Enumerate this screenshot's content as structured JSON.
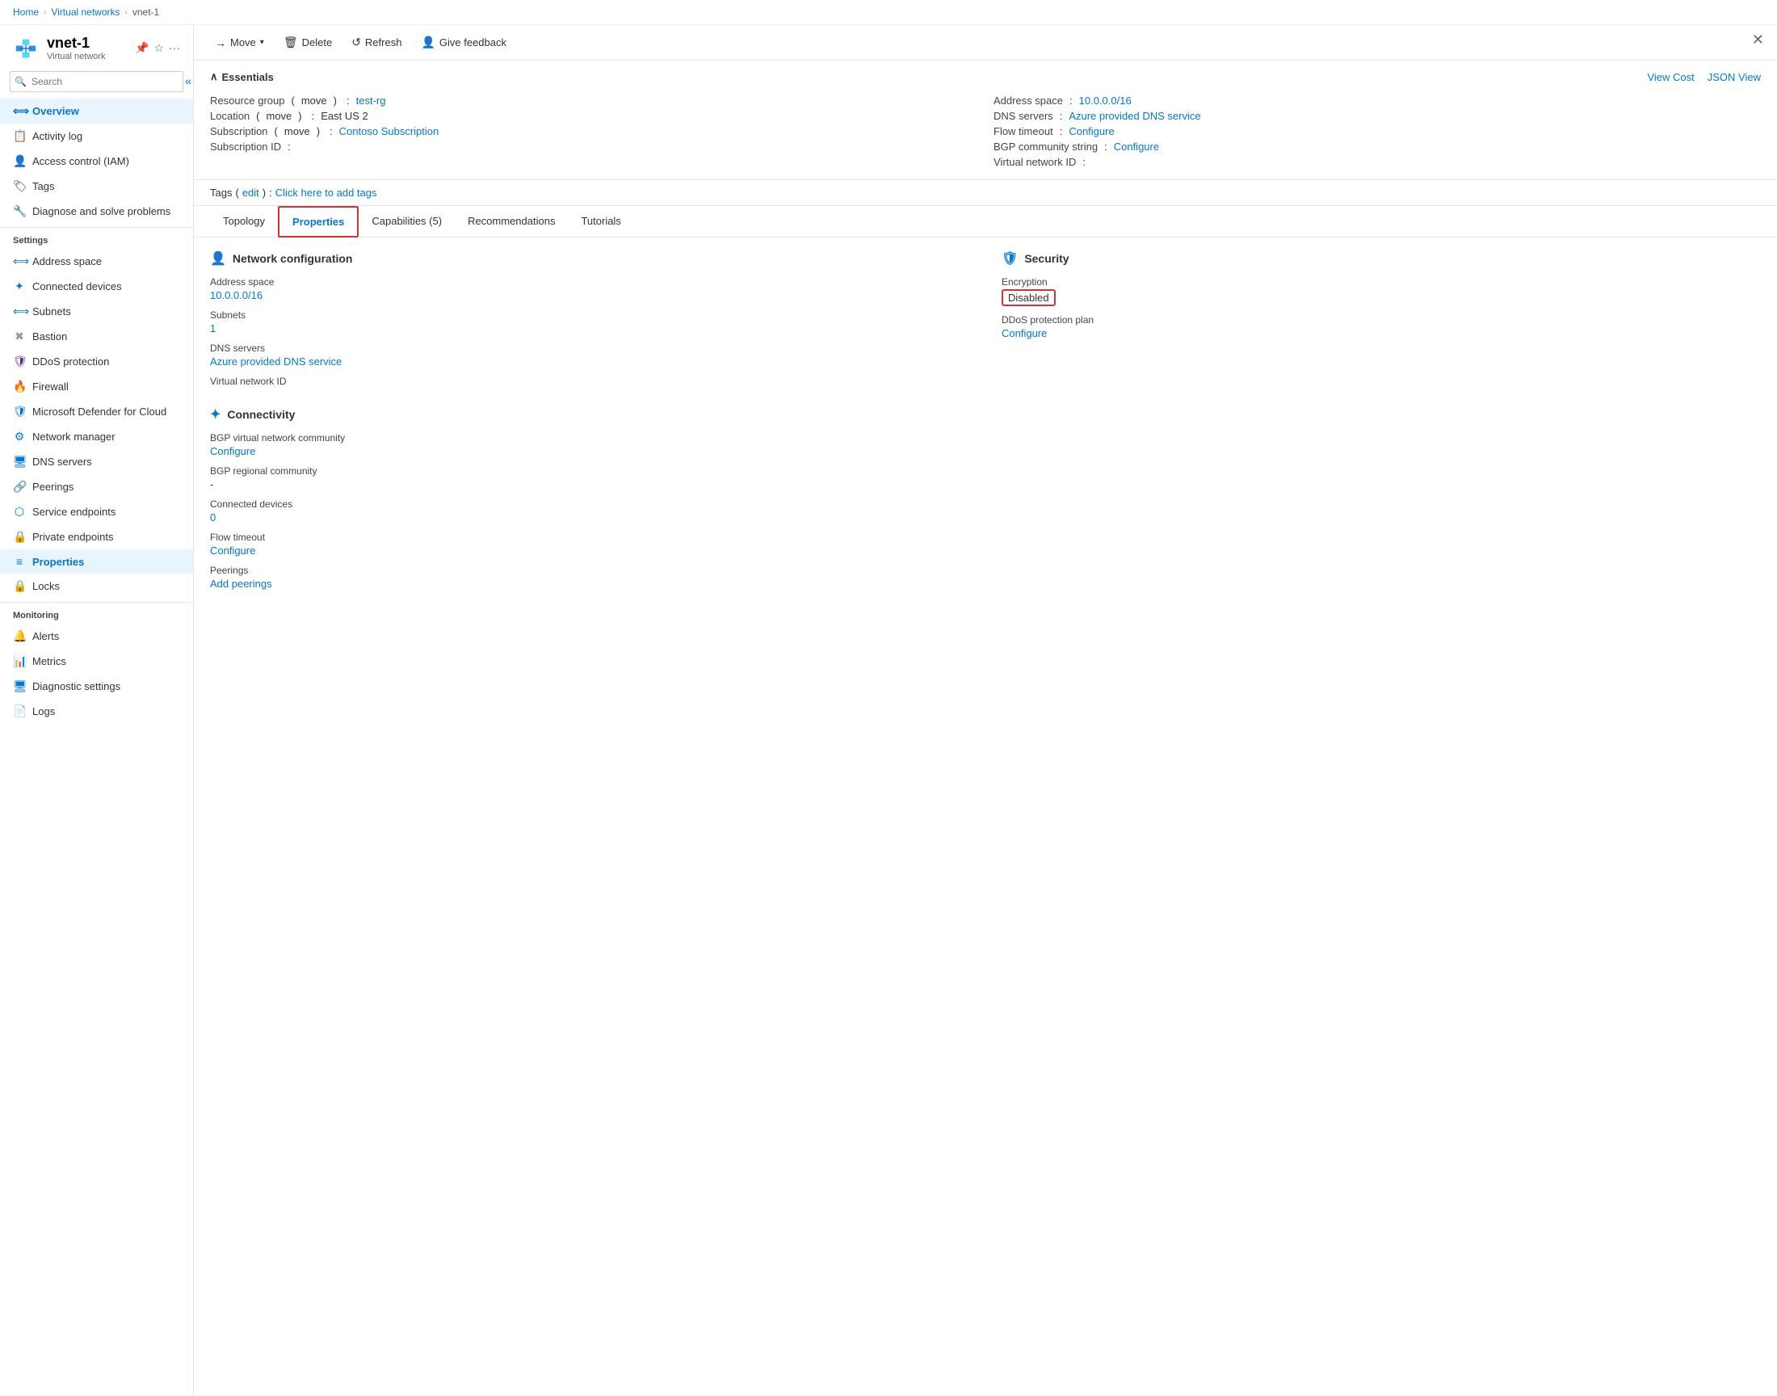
{
  "breadcrumb": {
    "home": "Home",
    "virtual_networks": "Virtual networks",
    "current": "vnet-1"
  },
  "sidebar": {
    "resource_name": "vnet-1",
    "resource_type": "Virtual network",
    "search_placeholder": "Search",
    "collapse_icon": "«",
    "nav_items": [
      {
        "id": "overview",
        "label": "Overview",
        "icon": "⟺",
        "active": false,
        "section": null
      },
      {
        "id": "activity-log",
        "label": "Activity log",
        "icon": "📋",
        "active": false,
        "section": null
      },
      {
        "id": "access-control",
        "label": "Access control (IAM)",
        "icon": "👤",
        "active": false,
        "section": null
      },
      {
        "id": "tags",
        "label": "Tags",
        "icon": "🏷",
        "active": false,
        "section": null
      },
      {
        "id": "diagnose",
        "label": "Diagnose and solve problems",
        "icon": "🔧",
        "active": false,
        "section": null
      }
    ],
    "settings_label": "Settings",
    "settings_items": [
      {
        "id": "address-space",
        "label": "Address space",
        "icon": "⟺"
      },
      {
        "id": "connected-devices",
        "label": "Connected devices",
        "icon": "✦"
      },
      {
        "id": "subnets",
        "label": "Subnets",
        "icon": "⟺"
      },
      {
        "id": "bastion",
        "label": "Bastion",
        "icon": "✖"
      },
      {
        "id": "ddos-protection",
        "label": "DDoS protection",
        "icon": "🛡"
      },
      {
        "id": "firewall",
        "label": "Firewall",
        "icon": "🔥"
      },
      {
        "id": "defender",
        "label": "Microsoft Defender for Cloud",
        "icon": "🛡"
      },
      {
        "id": "network-manager",
        "label": "Network manager",
        "icon": "⚙"
      },
      {
        "id": "dns-servers",
        "label": "DNS servers",
        "icon": "🖥"
      },
      {
        "id": "peerings",
        "label": "Peerings",
        "icon": "🔗"
      },
      {
        "id": "service-endpoints",
        "label": "Service endpoints",
        "icon": "⬡"
      },
      {
        "id": "private-endpoints",
        "label": "Private endpoints",
        "icon": "🔒"
      },
      {
        "id": "properties",
        "label": "Properties",
        "icon": "≡",
        "active": true
      },
      {
        "id": "locks",
        "label": "Locks",
        "icon": "🔒"
      }
    ],
    "monitoring_label": "Monitoring",
    "monitoring_items": [
      {
        "id": "alerts",
        "label": "Alerts",
        "icon": "🔔"
      },
      {
        "id": "metrics",
        "label": "Metrics",
        "icon": "📊"
      },
      {
        "id": "diagnostic-settings",
        "label": "Diagnostic settings",
        "icon": "🖥"
      },
      {
        "id": "logs",
        "label": "Logs",
        "icon": "📄"
      }
    ]
  },
  "toolbar": {
    "move_label": "Move",
    "delete_label": "Delete",
    "refresh_label": "Refresh",
    "feedback_label": "Give feedback"
  },
  "essentials": {
    "header": "Essentials",
    "view_cost": "View Cost",
    "json_view": "JSON View",
    "resource_group_label": "Resource group",
    "resource_group_link": "move",
    "resource_group_value": "test-rg",
    "location_label": "Location",
    "location_link": "move",
    "location_value": "East US 2",
    "subscription_label": "Subscription",
    "subscription_link": "move",
    "subscription_value": "Contoso Subscription",
    "subscription_id_label": "Subscription ID",
    "subscription_id_value": "",
    "address_space_label": "Address space",
    "address_space_value": "10.0.0.0/16",
    "dns_servers_label": "DNS servers",
    "dns_servers_value": "Azure provided DNS service",
    "flow_timeout_label": "Flow timeout",
    "flow_timeout_value": "Configure",
    "bgp_community_label": "BGP community string",
    "bgp_community_value": "Configure",
    "virtual_network_id_label": "Virtual network ID",
    "virtual_network_id_value": ""
  },
  "tags": {
    "label": "Tags",
    "edit_link": "edit",
    "add_link": "Click here to add tags"
  },
  "tabs": [
    {
      "id": "topology",
      "label": "Topology",
      "active": false
    },
    {
      "id": "properties",
      "label": "Properties",
      "active": true,
      "outlined": true
    },
    {
      "id": "capabilities",
      "label": "Capabilities (5)",
      "active": false
    },
    {
      "id": "recommendations",
      "label": "Recommendations",
      "active": false
    },
    {
      "id": "tutorials",
      "label": "Tutorials",
      "active": false
    }
  ],
  "properties": {
    "network_config": {
      "header": "Network configuration",
      "address_space_label": "Address space",
      "address_space_value": "10.0.0.0/16",
      "subnets_label": "Subnets",
      "subnets_value": "1",
      "dns_servers_label": "DNS servers",
      "dns_servers_value": "Azure provided DNS service",
      "virtual_network_id_label": "Virtual network ID"
    },
    "security": {
      "header": "Security",
      "encryption_label": "Encryption",
      "encryption_value": "Disabled",
      "ddos_label": "DDoS protection plan",
      "ddos_value": "Configure"
    },
    "connectivity": {
      "header": "Connectivity",
      "bgp_community_label": "BGP virtual network community",
      "bgp_community_value": "Configure",
      "bgp_regional_label": "BGP regional community",
      "bgp_regional_value": "-",
      "connected_devices_label": "Connected devices",
      "connected_devices_value": "0",
      "flow_timeout_label": "Flow timeout",
      "flow_timeout_value": "Configure",
      "peerings_label": "Peerings",
      "peerings_value": "Add peerings"
    }
  }
}
